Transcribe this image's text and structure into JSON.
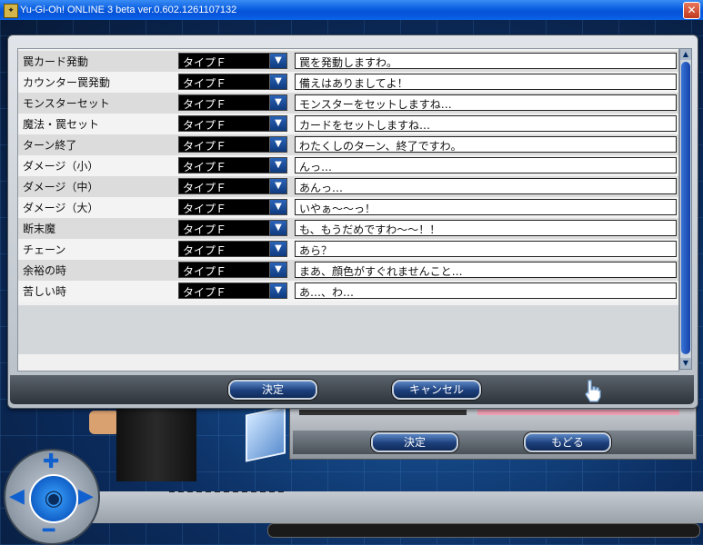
{
  "window": {
    "title": "Yu-Gi-Oh! ONLINE 3 beta ver.0.602.1261107132",
    "close_glyph": "✕"
  },
  "dialog": {
    "rows": [
      {
        "label": "罠カード発動",
        "type": "タイプＦ",
        "line": "罠を発動しますわ。"
      },
      {
        "label": "カウンター罠発動",
        "type": "タイプＦ",
        "line": "備えはありましてよ！"
      },
      {
        "label": "モンスターセット",
        "type": "タイプＦ",
        "line": "モンスターをセットしますね…"
      },
      {
        "label": "魔法・罠セット",
        "type": "タイプＦ",
        "line": "カードをセットしますね…"
      },
      {
        "label": "ターン終了",
        "type": "タイプＦ",
        "line": "わたくしのターン、終了ですわ。"
      },
      {
        "label": "ダメージ（小）",
        "type": "タイプＦ",
        "line": "んっ…"
      },
      {
        "label": "ダメージ（中）",
        "type": "タイプＦ",
        "line": "あんっ…"
      },
      {
        "label": "ダメージ（大）",
        "type": "タイプＦ",
        "line": "いやぁ～～っ！"
      },
      {
        "label": "断末魔",
        "type": "タイプＦ",
        "line": "も、もうだめですわ～～！！"
      },
      {
        "label": "チェーン",
        "type": "タイプＦ",
        "line": "あら？"
      },
      {
        "label": "余裕の時",
        "type": "タイプＦ",
        "line": "まあ、顔色がすぐれませんこと…"
      },
      {
        "label": "苦しい時",
        "type": "タイプＦ",
        "line": "あ…、わ…"
      }
    ],
    "confirm_label": "決定",
    "cancel_label": "キャンセル"
  },
  "subpanel": {
    "confirm_label": "決定",
    "back_label": "もどる"
  },
  "colors": {
    "accent": "#1c3f7c",
    "titlebar": "#0551d6"
  },
  "icons": {
    "dropdown": "dropdown-arrow-icon",
    "cursor": "hand-cursor-icon",
    "camera": "camera-icon"
  }
}
